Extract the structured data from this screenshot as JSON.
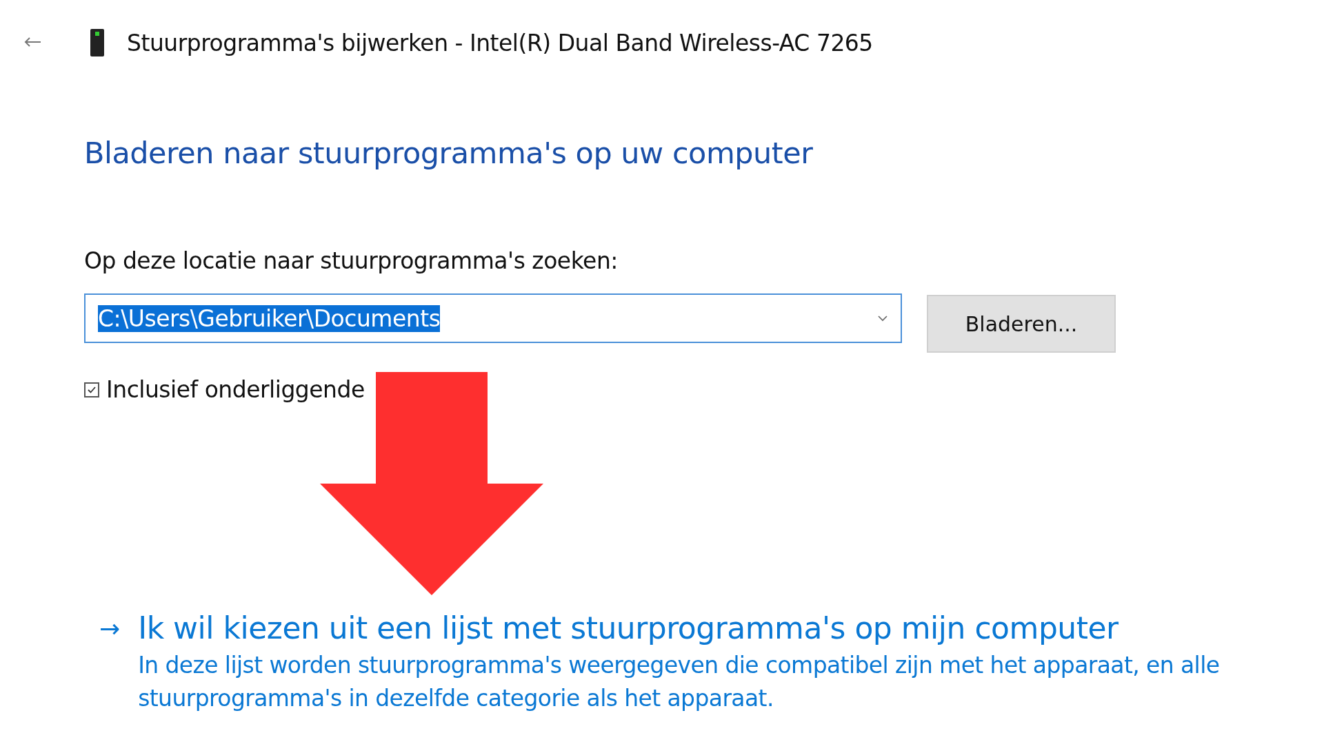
{
  "window": {
    "title": "Stuurprogramma's bijwerken - Intel(R) Dual Band Wireless-AC 7265"
  },
  "heading": "Bladeren naar stuurprogramma's op uw computer",
  "location": {
    "label": "Op deze locatie naar stuurprogramma's zoeken:",
    "value": "C:\\Users\\Gebruiker\\Documents",
    "text_selected": true,
    "browse_button": "Bladeren..."
  },
  "subfolders": {
    "label": "Inclusief onderliggende",
    "checked": true
  },
  "pick_link": {
    "arrow": "→",
    "title": "Ik wil kiezen uit een lijst met stuurprogramma's op mijn computer",
    "description": "In deze lijst worden stuurprogramma's weergegeven die compatibel zijn met het apparaat, en alle stuurprogramma's in dezelfde categorie als het apparaat."
  },
  "annotation": {
    "kind": "arrow-down",
    "color": "#fe2f2f"
  }
}
